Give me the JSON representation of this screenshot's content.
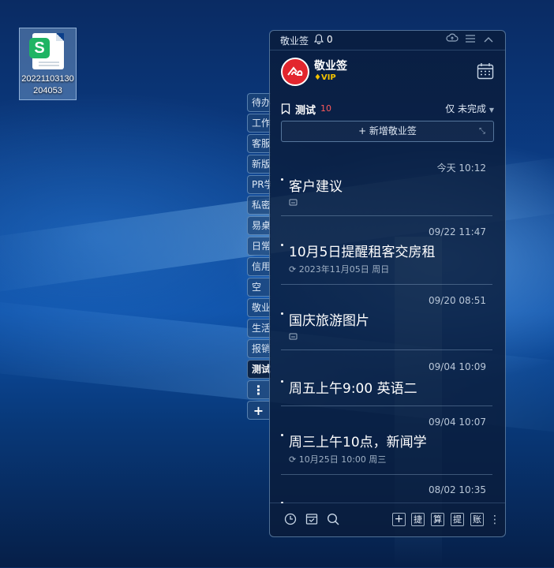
{
  "desktop": {
    "file_icon": {
      "label": "20221103130204053",
      "badge_letter": "S",
      "badge_color": "#1fb463"
    }
  },
  "side_tabs": [
    "待办",
    "工作",
    "客服",
    "新版",
    "PR学",
    "私密",
    "易桌",
    "日常",
    "信用",
    "空",
    "敬业",
    "生活",
    "报销",
    "测试"
  ],
  "side_tools": {
    "more": "⋮",
    "add": "+"
  },
  "widget": {
    "titlebar": {
      "app_name": "敬业签",
      "notification_count": "0",
      "bell": "bell-icon"
    },
    "user": {
      "name": "敬业签",
      "vip_label": "VIP",
      "vip_color": "#f2c200"
    },
    "list": {
      "name": "测试",
      "count": "10",
      "filter": "仅 未完成"
    },
    "add_button": "+ 新增敬业签",
    "notes": [
      {
        "time": "今天 10:12",
        "title": "客户建议",
        "has_lock": true,
        "reminder": ""
      },
      {
        "time": "09/22 11:47",
        "title": "10月5日提醒租客交房租",
        "has_lock": false,
        "reminder": "2023年11月05日 周日"
      },
      {
        "time": "09/20 08:51",
        "title": "国庆旅游图片",
        "has_lock": true,
        "reminder": ""
      },
      {
        "time": "09/04 10:09",
        "title": "周五上午9:00  英语二",
        "has_lock": false,
        "reminder": ""
      },
      {
        "time": "09/04 10:07",
        "title": "周三上午10点，新闻学",
        "has_lock": false,
        "reminder": "10月25日 10:00 周三"
      },
      {
        "time": "08/02 10:35",
        "title": "",
        "has_lock": false,
        "reminder": ""
      }
    ],
    "bottom_tools": [
      "捷",
      "算",
      "提",
      "账"
    ],
    "accent_color": "#ff5a5a"
  }
}
